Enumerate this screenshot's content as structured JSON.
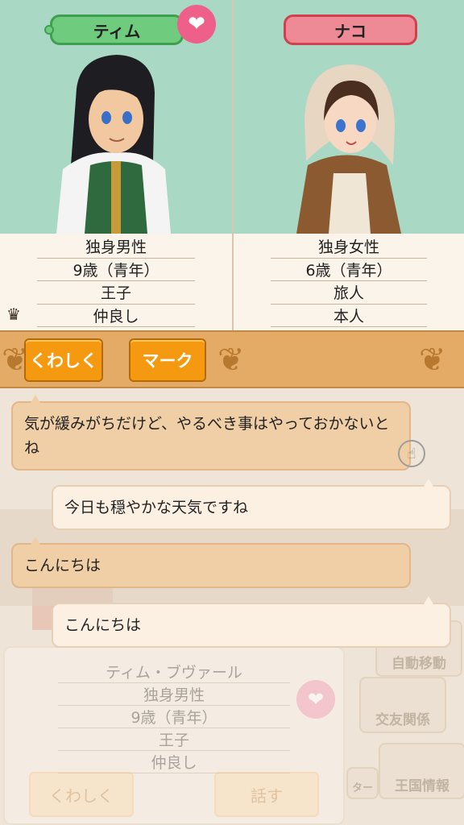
{
  "left_character": {
    "name": "ティム",
    "info": [
      "独身男性",
      "9歳（青年）",
      "王子",
      "仲良し"
    ],
    "heart_icon": "heart-icon"
  },
  "right_character": {
    "name": "ナコ",
    "info": [
      "独身女性",
      "6歳（青年）",
      "旅人",
      "本人"
    ]
  },
  "toolbar": {
    "details_label": "くわしく",
    "mark_label": "マーク"
  },
  "chat": [
    {
      "side": "left",
      "text": "気が緩みがちだけど、やるべき事はやっておかないとね"
    },
    {
      "side": "right",
      "text": "今日も穏やかな天気ですね"
    },
    {
      "side": "left",
      "text": "こんにちは"
    },
    {
      "side": "right",
      "text": "こんにちは"
    }
  ],
  "background_card": {
    "full_name": "ティム・ブヴァール",
    "info": [
      "独身男性",
      "9歳（青年）",
      "王子",
      "仲良し"
    ],
    "details_label": "くわしく",
    "talk_label": "話す"
  },
  "side_menu": {
    "auto_move": "自動移動",
    "relations": "交友関係",
    "kingdom_info": "王国情報",
    "center_label": "ター"
  },
  "colors": {
    "portrait_bg": "#a9d8c4",
    "male_badge": "#6fcb7e",
    "female_badge": "#ee8a95",
    "button_orange": "#f59a10"
  }
}
